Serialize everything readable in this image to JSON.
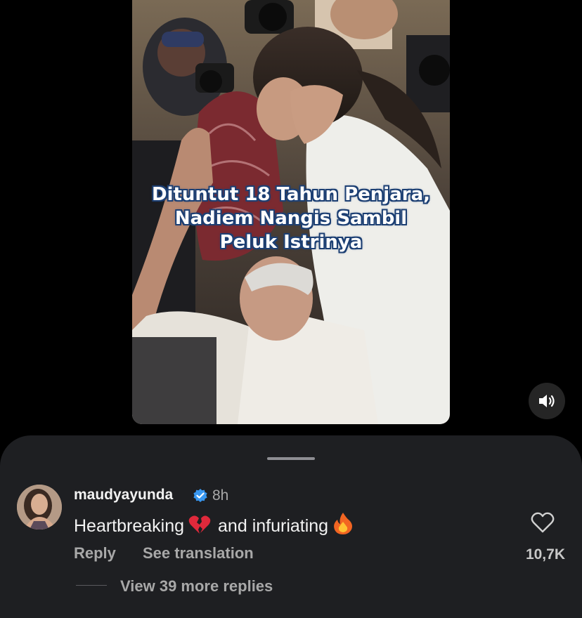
{
  "video": {
    "caption_lines": [
      "Dituntut 18 Tahun Penjara,",
      "Nadiem Nangis Sambil",
      "Peluk Istrinya"
    ],
    "sound_icon": "speaker-icon"
  },
  "comment": {
    "username": "maudyayunda",
    "verified": true,
    "time": "8h",
    "text_part1": "Heartbreaking",
    "emoji1": "broken-heart",
    "text_part2": "and infuriating",
    "emoji2": "fire",
    "reply_label": "Reply",
    "translate_label": "See translation",
    "likes": "10,7K",
    "view_replies": "View 39 more replies"
  },
  "colors": {
    "sheet_bg": "#1e1f22",
    "caption_outline": "#1c3f73",
    "verified_blue": "#3897f0",
    "secondary_text": "#a8a8a8"
  }
}
